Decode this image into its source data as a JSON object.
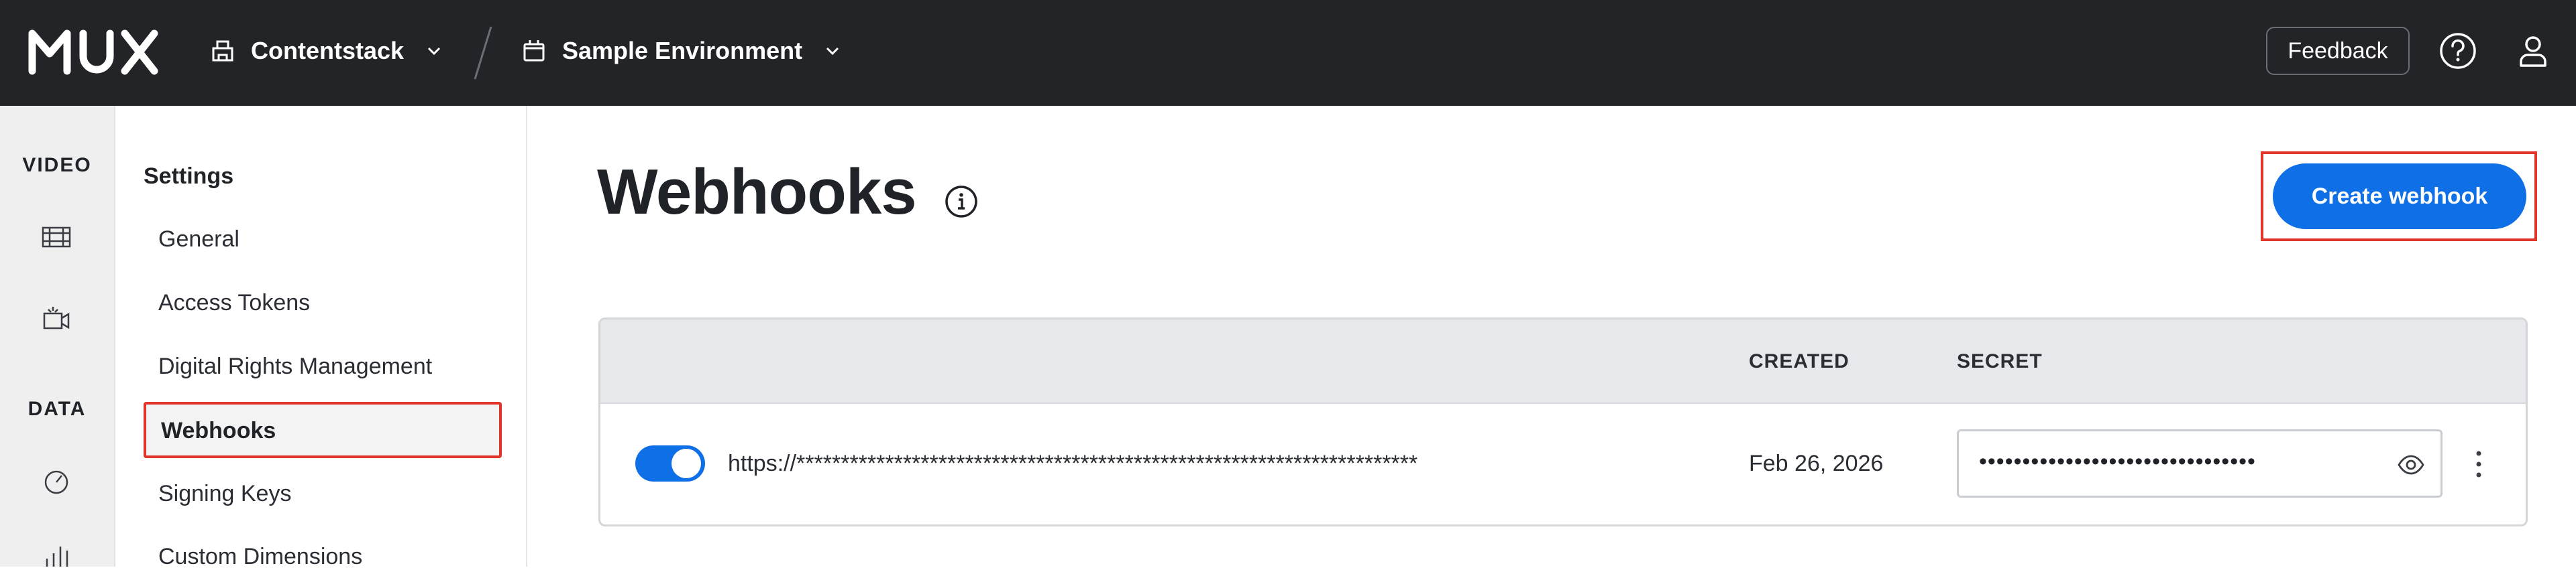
{
  "app": {
    "logo_text": "MUX"
  },
  "header": {
    "organization": "Contentstack",
    "environment": "Sample Environment",
    "feedback_label": "Feedback",
    "icons": [
      "organization-icon",
      "chevron-down-icon",
      "environment-icon",
      "help-icon",
      "user-icon"
    ]
  },
  "rail": {
    "sections": [
      {
        "label": "VIDEO",
        "icons": [
          "film-icon",
          "live-camera-icon"
        ]
      },
      {
        "label": "DATA",
        "icons": [
          "gauge-icon",
          "bar-chart-icon"
        ]
      }
    ]
  },
  "settings_nav": {
    "title": "Settings",
    "items": [
      {
        "label": "General"
      },
      {
        "label": "Access Tokens"
      },
      {
        "label": "Digital Rights Management"
      },
      {
        "label": "Webhooks",
        "active": true
      },
      {
        "label": "Signing Keys"
      },
      {
        "label": "Custom Dimensions"
      }
    ]
  },
  "main": {
    "title": "Webhooks",
    "create_button": "Create webhook",
    "table": {
      "columns": [
        "",
        "CREATED",
        "SECRET"
      ],
      "rows": [
        {
          "enabled": true,
          "url": "https://**********************************************************************",
          "created": "Feb 26, 2026",
          "secret": "••••••••••••••••••••••••••••••••"
        }
      ]
    }
  },
  "colors": {
    "primary": "#0f6fe6",
    "topbar": "#232428",
    "highlight": "#e0352b"
  }
}
